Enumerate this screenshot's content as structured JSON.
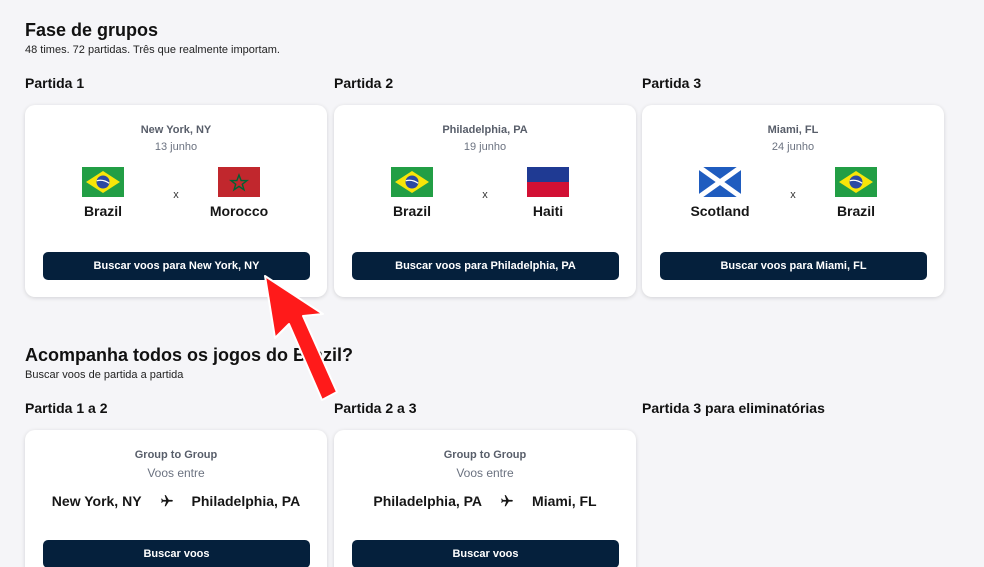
{
  "group_stage": {
    "title": "Fase de grupos",
    "subtitle": "48 times. 72 partidas. Três que realmente importam.",
    "matches": [
      {
        "label": "Partida 1",
        "city": "New York, NY",
        "date": "13 junho",
        "home": "Brazil",
        "away": "Morocco",
        "vs": "x",
        "button": "Buscar voos para New York, NY"
      },
      {
        "label": "Partida 2",
        "city": "Philadelphia, PA",
        "date": "19 junho",
        "home": "Brazil",
        "away": "Haiti",
        "vs": "x",
        "button": "Buscar voos para Philadelphia, PA"
      },
      {
        "label": "Partida 3",
        "city": "Miami, FL",
        "date": "24 junho",
        "home": "Scotland",
        "away": "Brazil",
        "vs": "x",
        "button": "Buscar voos para Miami, FL"
      }
    ]
  },
  "follow": {
    "title": "Acompanha todos os jogos do Brazil?",
    "subtitle": "Buscar voos de partida a partida",
    "routes": [
      {
        "label": "Partida 1 a 2",
        "title": "Group to Group",
        "sub": "Voos entre",
        "from": "New York, NY",
        "to": "Philadelphia, PA",
        "button": "Buscar voos"
      },
      {
        "label": "Partida 2 a 3",
        "title": "Group to Group",
        "sub": "Voos entre",
        "from": "Philadelphia, PA",
        "to": "Miami, FL",
        "button": "Buscar voos"
      },
      {
        "label": "Partida 3 para eliminatórias"
      }
    ]
  },
  "colors": {
    "button_bg": "#05203c",
    "annotation_arrow": "#ff1a1a",
    "page_bg": "#f5f5f8"
  },
  "icons": {
    "plane": "airplane-icon",
    "flags": [
      "brazil-flag-icon",
      "morocco-flag-icon",
      "haiti-flag-icon",
      "scotland-flag-icon"
    ]
  }
}
